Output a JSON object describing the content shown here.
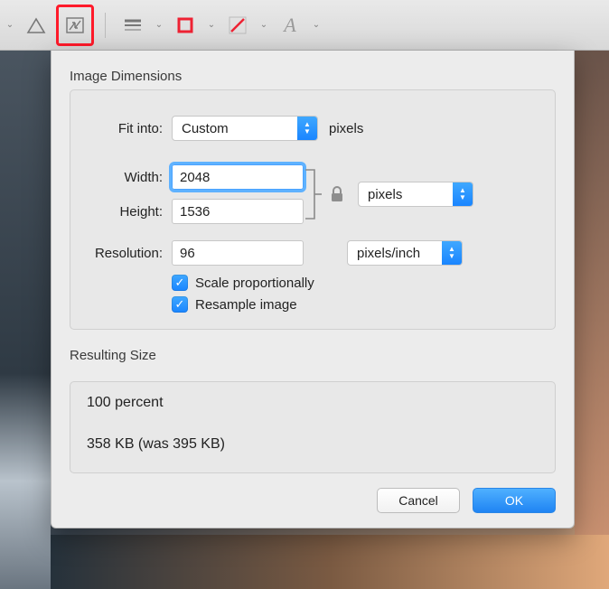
{
  "toolbar": {
    "dropdown_glyph": "⌄",
    "icons": {
      "adjust": "adjust-levels-icon",
      "resize": "resize-icon",
      "lines": "line-style-icon",
      "shape": "shape-rect-icon",
      "stroke": "diagonal-stroke-icon",
      "text": "text-style-icon"
    }
  },
  "dialog": {
    "section1_title": "Image Dimensions",
    "fit_label": "Fit into:",
    "fit_value": "Custom",
    "fit_unit": "pixels",
    "width_label": "Width:",
    "width_value": "2048",
    "height_label": "Height:",
    "height_value": "1536",
    "dim_unit": "pixels",
    "resolution_label": "Resolution:",
    "resolution_value": "96",
    "resolution_unit": "pixels/inch",
    "scale_checkbox": "Scale proportionally",
    "resample_checkbox": "Resample image",
    "section2_title": "Resulting Size",
    "percent_line": "100 percent",
    "size_line": "358 KB (was 395 KB)",
    "cancel": "Cancel",
    "ok": "OK"
  }
}
